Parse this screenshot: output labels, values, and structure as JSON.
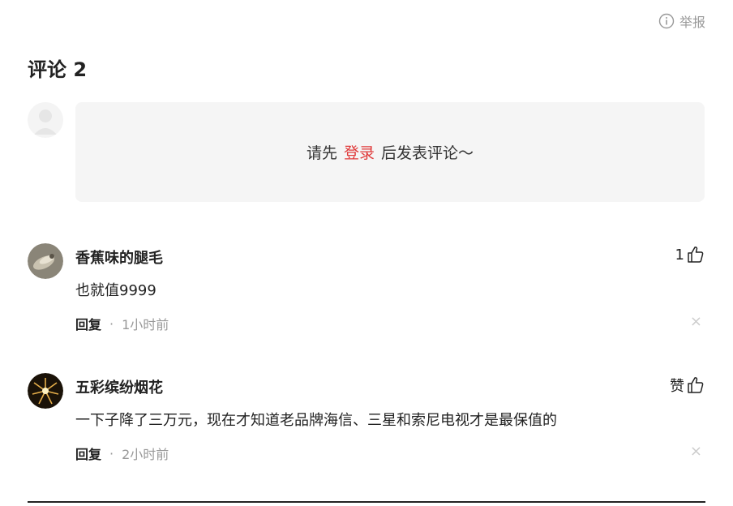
{
  "header": {
    "report_label": "举报",
    "report_icon": "info-circle-icon"
  },
  "comments_section": {
    "title": "评论 2"
  },
  "login_prompt": {
    "prefix": "请先",
    "link": "登录",
    "suffix": "后发表评论～",
    "link_color": "#e03a3a"
  },
  "comments": [
    {
      "username": "香蕉味的腿毛",
      "text": "也就值9999",
      "reply_label": "回复",
      "separator": "·",
      "time": "1小时前",
      "like_label": "1",
      "like_icon": "thumbs-up-icon",
      "close_label": "×"
    },
    {
      "username": "五彩缤纷烟花",
      "text": "一下子降了三万元，现在才知道老品牌海信、三星和索尼电视才是最保值的",
      "reply_label": "回复",
      "separator": "·",
      "time": "2小时前",
      "like_label": "赞",
      "like_icon": "thumbs-up-icon",
      "close_label": "×"
    }
  ]
}
